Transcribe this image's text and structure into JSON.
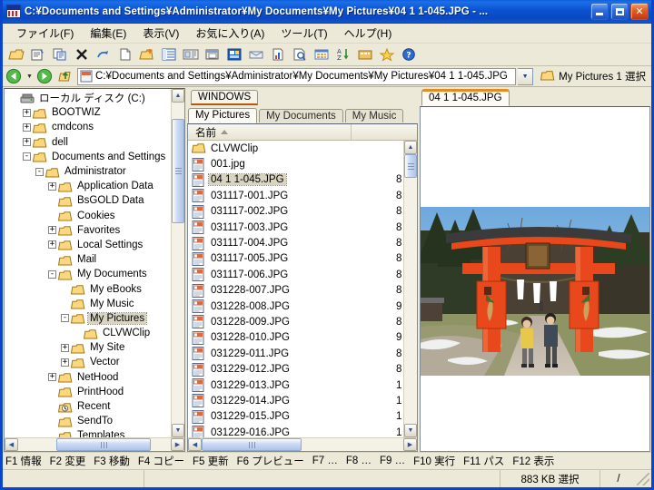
{
  "window": {
    "title": "C:¥Documents and Settings¥Administrator¥My Documents¥My Pictures¥04 1 1-045.JPG - ...",
    "minimize_label": "",
    "maximize_label": "",
    "close_label": "✕",
    "title_icon": "app-icon"
  },
  "menubar": {
    "items": [
      {
        "label": "ファイル(F)",
        "name": "menu-file"
      },
      {
        "label": "編集(E)",
        "name": "menu-edit"
      },
      {
        "label": "表示(V)",
        "name": "menu-view"
      },
      {
        "label": "お気に入り(A)",
        "name": "menu-favorites"
      },
      {
        "label": "ツール(T)",
        "name": "menu-tools"
      },
      {
        "label": "ヘルプ(H)",
        "name": "menu-help"
      }
    ]
  },
  "toolbar": {
    "buttons": [
      "open-folder-icon",
      "folder-properties-icon",
      "copy-icon",
      "delete-icon",
      "redo-icon",
      "new-file-icon",
      "new-folder-icon",
      "list-view-icon",
      "details-view-icon",
      "window-icon",
      "image-view-icon",
      "envelope-icon",
      "report-icon",
      "search-file-icon",
      "thumbnail-view-icon",
      "sort-az-icon",
      "archive-icon",
      "favorites-star-icon",
      "help-icon"
    ]
  },
  "addressbar": {
    "back_icon": "back-arrow-icon",
    "back_dropdown_icon": "chevron-down-icon",
    "forward_icon": "forward-arrow-icon",
    "up_icon": "up-folder-icon",
    "path_icon": "file-jpg-icon",
    "path": "C:¥Documents and Settings¥Administrator¥My Documents¥My Pictures¥04 1 1-045.JPG",
    "dropdown_icon": "chevron-down-icon",
    "right_icon": "folder-icon",
    "right_label": "My Pictures  1 選択"
  },
  "tree": {
    "items": [
      {
        "label": "ローカル ディスク (C:)",
        "depth": 0,
        "expander": "none",
        "icon": "drive-icon",
        "selected": false
      },
      {
        "label": "BOOTWIZ",
        "depth": 1,
        "expander": "+",
        "icon": "folder-icon",
        "selected": false
      },
      {
        "label": "cmdcons",
        "depth": 1,
        "expander": "+",
        "icon": "folder-icon",
        "selected": false
      },
      {
        "label": "dell",
        "depth": 1,
        "expander": "+",
        "icon": "folder-icon",
        "selected": false
      },
      {
        "label": "Documents and Settings",
        "depth": 1,
        "expander": "-",
        "icon": "folder-icon",
        "selected": false
      },
      {
        "label": "Administrator",
        "depth": 2,
        "expander": "-",
        "icon": "folder-icon",
        "selected": false
      },
      {
        "label": "Application Data",
        "depth": 3,
        "expander": "+",
        "icon": "folder-icon",
        "selected": false
      },
      {
        "label": "BsGOLD Data",
        "depth": 3,
        "expander": "none",
        "icon": "folder-icon",
        "selected": false
      },
      {
        "label": "Cookies",
        "depth": 3,
        "expander": "none",
        "icon": "folder-icon",
        "selected": false
      },
      {
        "label": "Favorites",
        "depth": 3,
        "expander": "+",
        "icon": "folder-icon",
        "selected": false
      },
      {
        "label": "Local Settings",
        "depth": 3,
        "expander": "+",
        "icon": "folder-icon",
        "selected": false
      },
      {
        "label": "Mail",
        "depth": 3,
        "expander": "none",
        "icon": "folder-icon",
        "selected": false
      },
      {
        "label": "My Documents",
        "depth": 3,
        "expander": "-",
        "icon": "folder-icon",
        "selected": false
      },
      {
        "label": "My eBooks",
        "depth": 4,
        "expander": "none",
        "icon": "folder-icon",
        "selected": false
      },
      {
        "label": "My Music",
        "depth": 4,
        "expander": "none",
        "icon": "folder-icon",
        "selected": false
      },
      {
        "label": "My Pictures",
        "depth": 4,
        "expander": "-",
        "icon": "folder-icon",
        "selected": true
      },
      {
        "label": "CLVWClip",
        "depth": 5,
        "expander": "none",
        "icon": "folder-icon",
        "selected": false
      },
      {
        "label": "My Site",
        "depth": 4,
        "expander": "+",
        "icon": "folder-icon",
        "selected": false
      },
      {
        "label": "Vector",
        "depth": 4,
        "expander": "+",
        "icon": "folder-icon",
        "selected": false
      },
      {
        "label": "NetHood",
        "depth": 3,
        "expander": "+",
        "icon": "folder-icon",
        "selected": false
      },
      {
        "label": "PrintHood",
        "depth": 3,
        "expander": "none",
        "icon": "folder-icon",
        "selected": false
      },
      {
        "label": "Recent",
        "depth": 3,
        "expander": "none",
        "icon": "recent-folder-icon",
        "selected": false
      },
      {
        "label": "SendTo",
        "depth": 3,
        "expander": "none",
        "icon": "folder-icon",
        "selected": false
      },
      {
        "label": "Templates",
        "depth": 3,
        "expander": "none",
        "icon": "folder-icon",
        "selected": false
      }
    ]
  },
  "filelist": {
    "tab_top": "WINDOWS",
    "tabs": [
      {
        "label": "My Pictures",
        "active": true
      },
      {
        "label": "My Documents",
        "active": false
      },
      {
        "label": "My Music",
        "active": false
      }
    ],
    "column_name": "名前",
    "sort_direction": "ascending",
    "rows": [
      {
        "name": "CLVWClip",
        "size": "",
        "icon": "folder-icon",
        "selected": false
      },
      {
        "name": "001.jpg",
        "size": "",
        "icon": "file-jpg-icon",
        "selected": false
      },
      {
        "name": "04 1 1-045.JPG",
        "size": "8",
        "icon": "file-jpg-icon",
        "selected": true
      },
      {
        "name": "031117-001.JPG",
        "size": "8",
        "icon": "file-jpg-icon",
        "selected": false
      },
      {
        "name": "031117-002.JPG",
        "size": "8",
        "icon": "file-jpg-icon",
        "selected": false
      },
      {
        "name": "031117-003.JPG",
        "size": "8",
        "icon": "file-jpg-icon",
        "selected": false
      },
      {
        "name": "031117-004.JPG",
        "size": "8",
        "icon": "file-jpg-icon",
        "selected": false
      },
      {
        "name": "031117-005.JPG",
        "size": "8",
        "icon": "file-jpg-icon",
        "selected": false
      },
      {
        "name": "031117-006.JPG",
        "size": "8",
        "icon": "file-jpg-icon",
        "selected": false
      },
      {
        "name": "031228-007.JPG",
        "size": "8",
        "icon": "file-jpg-icon",
        "selected": false
      },
      {
        "name": "031228-008.JPG",
        "size": "9",
        "icon": "file-jpg-icon",
        "selected": false
      },
      {
        "name": "031228-009.JPG",
        "size": "8",
        "icon": "file-jpg-icon",
        "selected": false
      },
      {
        "name": "031228-010.JPG",
        "size": "9",
        "icon": "file-jpg-icon",
        "selected": false
      },
      {
        "name": "031229-011.JPG",
        "size": "8",
        "icon": "file-jpg-icon",
        "selected": false
      },
      {
        "name": "031229-012.JPG",
        "size": "8",
        "icon": "file-jpg-icon",
        "selected": false
      },
      {
        "name": "031229-013.JPG",
        "size": "1",
        "icon": "file-jpg-icon",
        "selected": false
      },
      {
        "name": "031229-014.JPG",
        "size": "1",
        "icon": "file-jpg-icon",
        "selected": false
      },
      {
        "name": "031229-015.JPG",
        "size": "1",
        "icon": "file-jpg-icon",
        "selected": false
      },
      {
        "name": "031229-016.JPG",
        "size": "1",
        "icon": "file-jpg-icon",
        "selected": false
      }
    ]
  },
  "preview": {
    "tab_label": "04 1 1-045.JPG",
    "image_alt": "torii-gate-photo"
  },
  "functionkeys": [
    "F1 情報",
    "F2 変更",
    "F3 移動",
    "F4 コピー",
    "F5 更新",
    "F6 プレビュー",
    "F7 …",
    "F8 …",
    "F9 …",
    "F10 実行",
    "F11 パス",
    "F12 表示"
  ],
  "statusbar": {
    "field1": "",
    "field2": "",
    "selected_size": "883 KB 選択",
    "field4": "/"
  },
  "colors": {
    "title_blue": "#0a46c0",
    "accent_orange": "#e98a20",
    "face": "#ece9d8",
    "selection": "#d8d4c0"
  }
}
